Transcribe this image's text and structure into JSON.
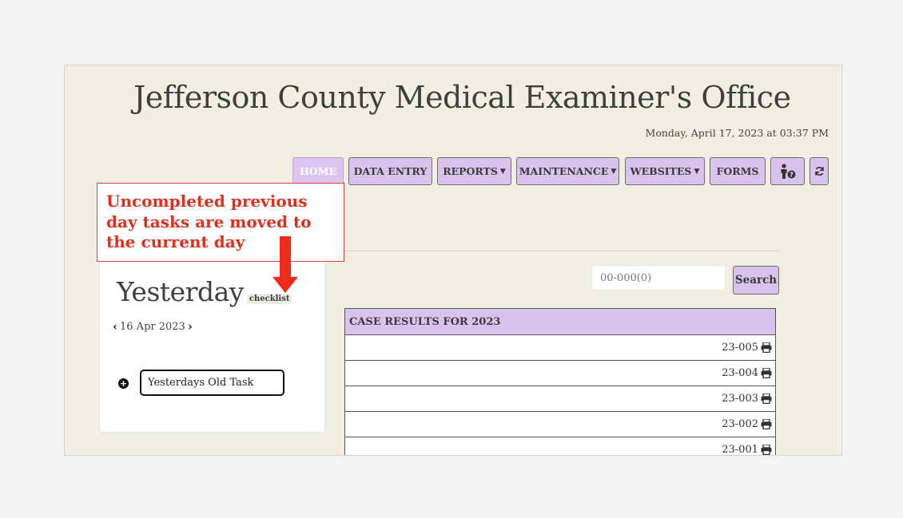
{
  "header": {
    "site_title": "Jefferson County Medical Examiner's Office",
    "datetime": "Monday, April 17, 2023 at 03:37 PM"
  },
  "nav": {
    "home": "HOME",
    "data_entry": "DATA ENTRY",
    "reports": "REPORTS",
    "maintenance": "MAINTENANCE",
    "websites": "WEBSITES",
    "forms": "FORMS",
    "help_icon": "person-help-icon",
    "refresh_icon": "refresh-icon",
    "caret_icon": "caret-down-icon"
  },
  "search": {
    "placeholder": "00-000(0)",
    "value": "",
    "button_label": "Search"
  },
  "results": {
    "header": "CASE RESULTS FOR 2023",
    "rows": [
      {
        "case_id": "23-005"
      },
      {
        "case_id": "23-004"
      },
      {
        "case_id": "23-003"
      },
      {
        "case_id": "23-002"
      },
      {
        "case_id": "23-001"
      }
    ],
    "row_icon": "printer-icon"
  },
  "checklist": {
    "title": "Yesterday",
    "subtitle": "checklist",
    "date": "16 Apr 2023",
    "prev_icon": "chevron-left-icon",
    "next_icon": "chevron-right-icon",
    "add_icon": "plus-circle-icon",
    "task_value": "Yesterdays Old Task"
  },
  "annotation": {
    "text": "Uncompleted previous day tasks are moved to the current day",
    "color": "#e02f1e",
    "arrow_icon": "arrow-down-icon"
  },
  "colors": {
    "nav_bg": "#d9c3ed",
    "page_bg": "#f0efe2"
  }
}
